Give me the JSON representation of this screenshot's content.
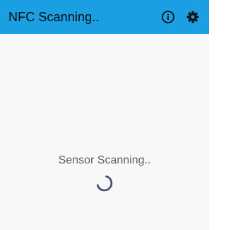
{
  "app_bar": {
    "title": "NFC Scanning..",
    "background_color": "#1a9fe3",
    "info_icon": "info-circle-icon",
    "settings_icon": "gear-icon"
  },
  "main": {
    "status_text": "Sensor Scanning..",
    "spinner_icon": "loading-spinner-icon",
    "spinner_color": "#3b4a6b"
  }
}
